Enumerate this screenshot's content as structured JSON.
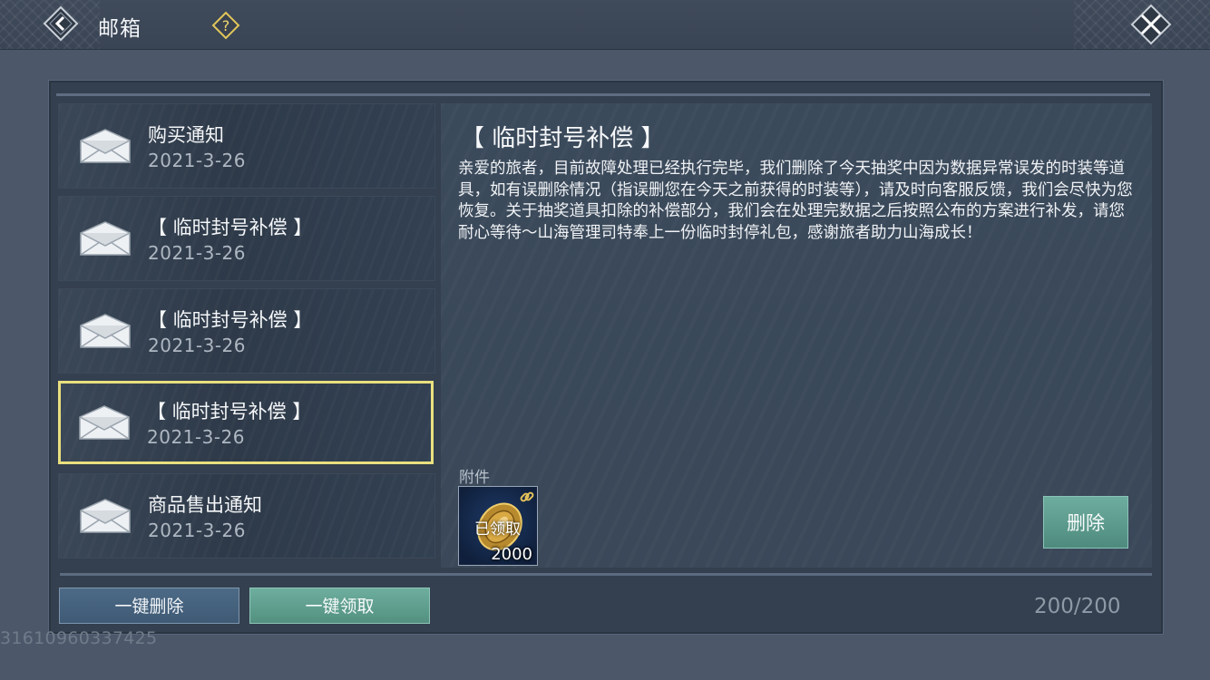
{
  "header": {
    "title": "邮箱",
    "back_icon": "back-arrow-icon",
    "help_icon": "question-icon",
    "close_icon": "close-icon"
  },
  "mail_list": [
    {
      "title": "购买通知",
      "date": "2021-3-26",
      "selected": false
    },
    {
      "title": "【 临时封号补偿 】",
      "date": "2021-3-26",
      "selected": false
    },
    {
      "title": "【 临时封号补偿 】",
      "date": "2021-3-26",
      "selected": false
    },
    {
      "title": "【 临时封号补偿 】",
      "date": "2021-3-26",
      "selected": true
    },
    {
      "title": "商品售出通知",
      "date": "2021-3-26",
      "selected": false
    }
  ],
  "detail": {
    "title": "【 临时封号补偿 】",
    "body": "亲爱的旅者，目前故障处理已经执行完毕，我们删除了今天抽奖中因为数据异常误发的时装等道具，如有误删除情况（指误删您在今天之前获得的时装等），请及时向客服反馈，我们会尽快为您恢复。关于抽奖道具扣除的补偿部分，我们会在处理完数据之后按照公布的方案进行补发，请您耐心等待～山海管理司特奉上一份临时封停礼包，感谢旅者助力山海成长！",
    "attachment_label": "附件",
    "attachment": {
      "status": "已领取",
      "quantity": "2000",
      "icon": "gold-coin-icon"
    },
    "delete_label": "删除"
  },
  "footer": {
    "delete_all_label": "一键删除",
    "claim_all_label": "一键领取",
    "count": "200/200",
    "uid": "31610960337425"
  },
  "colors": {
    "selected_border": "#e9df7e",
    "claim_button": "#5f9e8f",
    "delete_all_button": "#466380",
    "background": "#4c586a"
  }
}
